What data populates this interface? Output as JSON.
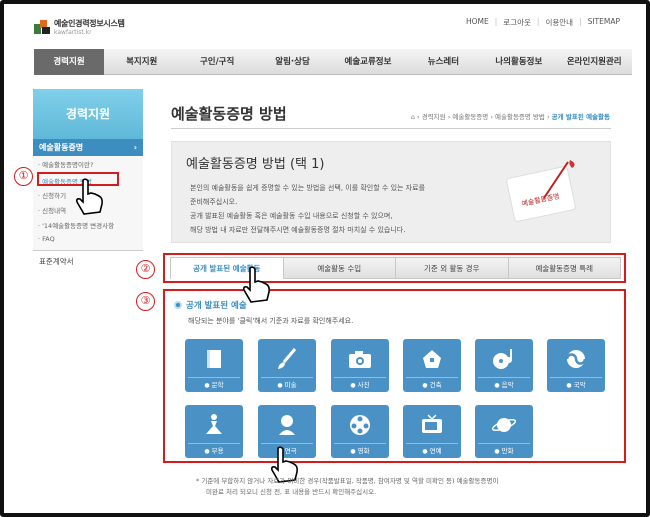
{
  "header": {
    "logo_title": "예술인경력정보시스템",
    "logo_sub": "kawfartist.kr",
    "util_links": [
      "HOME",
      "로그아웃",
      "이용안내",
      "SITEMAP"
    ]
  },
  "nav": [
    "경력지원",
    "복지지원",
    "구인/구직",
    "알림·상담",
    "예술교류정보",
    "뉴스레터",
    "나의활동정보",
    "온라인지원관리"
  ],
  "sidebar": {
    "title": "경력지원",
    "selected": "예술활동증명",
    "subitems": [
      "· 예술활동증명이란?",
      "· 예술활동증명 방법",
      "· 신청하기",
      "· 신청내역",
      "· '14예술활동증명 변경사항",
      "· FAQ"
    ],
    "bottom": "표준계약서"
  },
  "page": {
    "title": "예술활동증명 방법",
    "breadcrumb": [
      "경력지원",
      "예술활동증명",
      "예술활동증명 방법"
    ],
    "breadcrumb_current": "공개 발표된 예술활동"
  },
  "info": {
    "title": "예술활동증명 방법 (택 1)",
    "lines": [
      "본인의 예술활동을 쉽게 증명할 수 있는 방법을 선택, 이를 확인할 수 있는 자료를",
      "준비해주십시오.",
      "공개 발표된 예술활동 혹은 예술활동 수입 내용으로 신청할 수 있으며,",
      "해당 방법 내 자료만 전달해주시면 예술활동증명 절차 마치실 수 있습니다."
    ],
    "image_caption": "예술활동증명"
  },
  "tabs": [
    "공개 발표된 예술활동",
    "예술활동 수입",
    "기준 외 활동 경우",
    "예술활동증명 특례"
  ],
  "section": {
    "head": "공개 발표된 예술",
    "desc": "해당되는 분야를 '클릭'해서 기준과 자료를 확인해주세요."
  },
  "fields": [
    {
      "label": "문학",
      "icon": "book-icon"
    },
    {
      "label": "미술",
      "icon": "brush-icon"
    },
    {
      "label": "사진",
      "icon": "camera-icon"
    },
    {
      "label": "건축",
      "icon": "building-icon"
    },
    {
      "label": "음악",
      "icon": "music-icon"
    },
    {
      "label": "국악",
      "icon": "taeguk-icon"
    },
    {
      "label": "무용",
      "icon": "dance-icon"
    },
    {
      "label": "연극",
      "icon": "actor-icon"
    },
    {
      "label": "영화",
      "icon": "film-icon"
    },
    {
      "label": "연예",
      "icon": "tv-icon"
    },
    {
      "label": "만화",
      "icon": "planet-icon"
    }
  ],
  "note": {
    "line1": "* 기준에 부합하지 않거나 자료가 미비한 경우(작품발표일, 작품명, 참여자명 및 역할 미확인 등) 예술활동증명이",
    "line2": "미완료 처리 되오니 신청 전, 표 내용을 반드시 확인해주십시오."
  },
  "callouts": [
    "①",
    "②",
    "③"
  ],
  "colors": {
    "accent": "#3c8ec0",
    "card": "#4a92c6",
    "callout": "#d41c1c"
  }
}
